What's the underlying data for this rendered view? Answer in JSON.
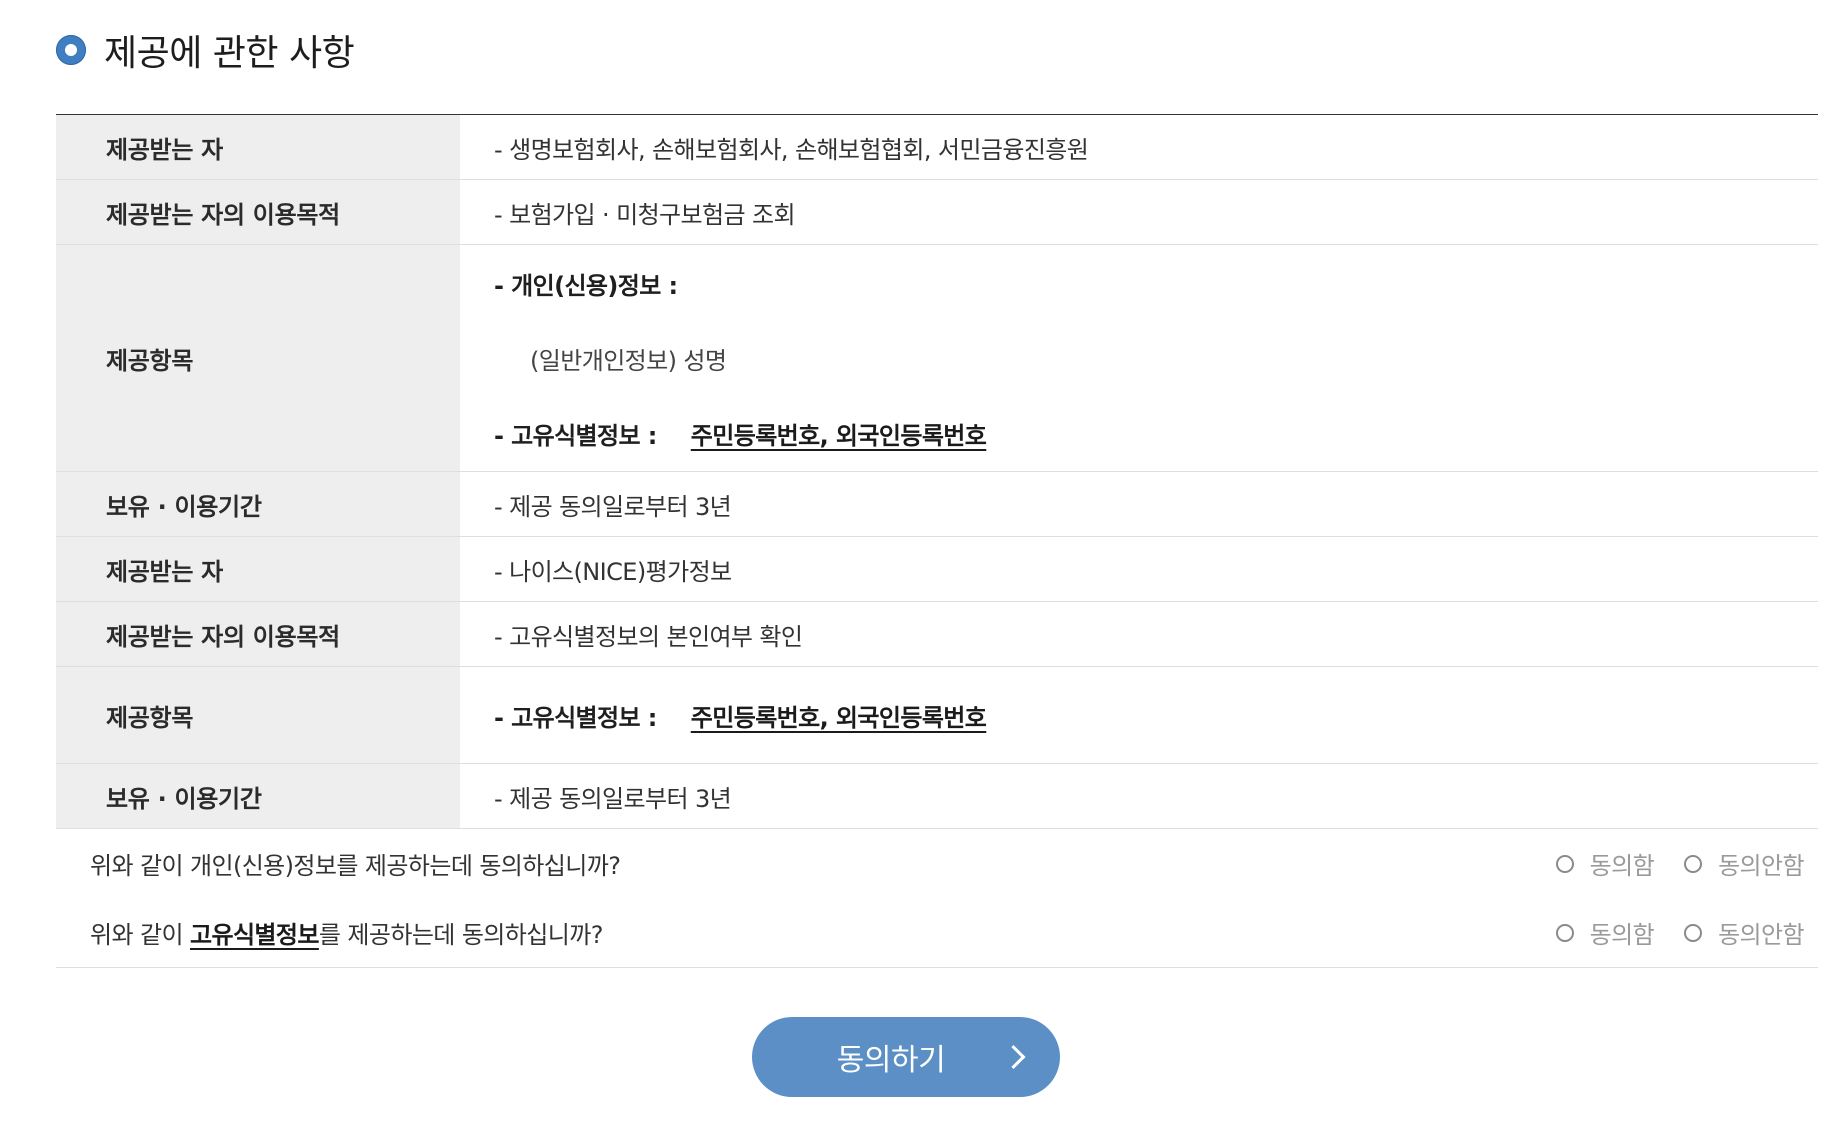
{
  "section": {
    "title": "제공에 관한 사항"
  },
  "rows": [
    {
      "label": "제공받는 자",
      "value": "- 생명보험회사, 손해보험회사, 손해보험협회, 서민금융진흥원"
    },
    {
      "label": "제공받는 자의 이용목적",
      "value": "- 보험가입 · 미청구보험금 조회"
    },
    {
      "label": "제공항목",
      "line1": "- 개인(신용)정보 :",
      "line2": "(일반개인정보)  성명",
      "line3_prefix": "- 고유식별정보 :",
      "line3_value": "주민등록번호, 외국인등록번호"
    },
    {
      "label": "보유 · 이용기간",
      "value": "- 제공 동의일로부터 3년"
    },
    {
      "label": "제공받는 자",
      "value": "- 나이스(NICE)평가정보"
    },
    {
      "label": "제공받는 자의 이용목적",
      "value": "- 고유식별정보의 본인여부 확인"
    },
    {
      "label": "제공항목",
      "prefix": "- 고유식별정보 :",
      "value": "주민등록번호, 외국인등록번호"
    },
    {
      "label": "보유 · 이용기간",
      "value": "- 제공 동의일로부터 3년"
    }
  ],
  "consent": [
    {
      "question": "위와 같이 개인(신용)정보를 제공하는데 동의하십니까?",
      "agree_label": "동의함",
      "disagree_label": "동의안함"
    },
    {
      "question_prefix": "위와 같이 ",
      "question_strong": "고유식별정보",
      "question_suffix": "를 제공하는데 동의하십니까?",
      "agree_label": "동의함",
      "disagree_label": "동의안함"
    }
  ],
  "button": {
    "label": "동의하기"
  },
  "icons": {
    "section_bullet": "circle-bullet-icon",
    "button_arrow": "chevron-right-icon",
    "radio": "radio-unchecked-icon"
  },
  "colors": {
    "accent": "#3f7fc1",
    "button_bg": "#5b8fc6",
    "label_bg": "#eeeeee"
  }
}
